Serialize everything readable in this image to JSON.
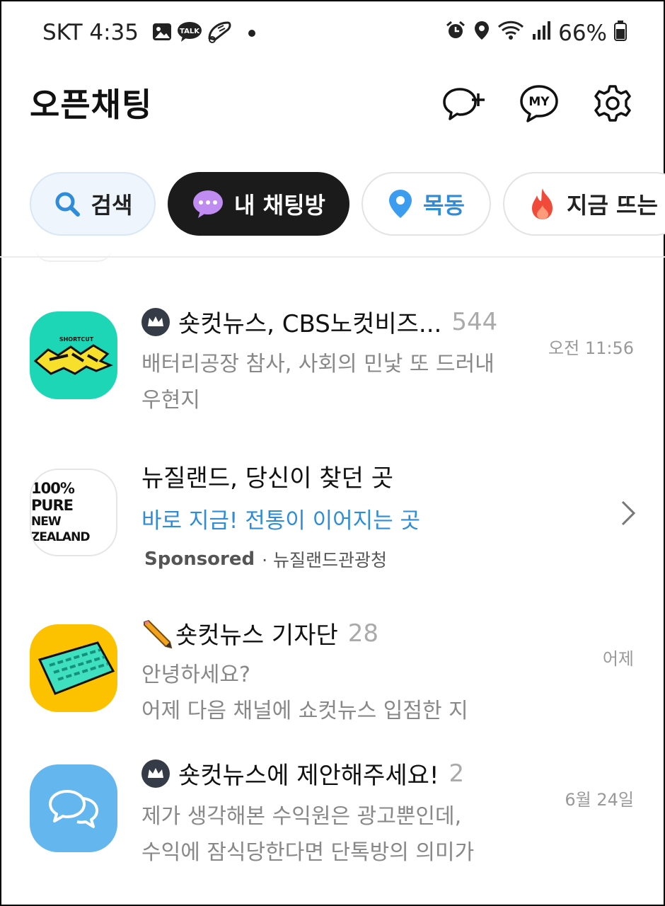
{
  "status_bar": {
    "carrier_time": "SKT 4:35",
    "battery": "66%",
    "left_icons": [
      "gallery-icon",
      "kakaotalk-icon",
      "sneaker-icon",
      "dot-icon"
    ],
    "right_icons": [
      "alarm-icon",
      "location-icon",
      "wifi-icon",
      "signal-icon",
      "battery-icon"
    ]
  },
  "header": {
    "title": "오픈채팅",
    "buttons": [
      "new-chat-icon",
      "my-icon",
      "settings-icon"
    ],
    "my_label": "MY"
  },
  "chips": [
    {
      "label": "검색",
      "icon": "search-icon"
    },
    {
      "label": "내 채팅방",
      "icon": "chat-bubble-icon",
      "active": true
    },
    {
      "label": "목동",
      "icon": "location-pin-icon"
    },
    {
      "label": "지금 뜨는",
      "icon": "fire-icon"
    }
  ],
  "chats": [
    {
      "name": "숏컷뉴스, CBS노컷비즈...",
      "count": "544",
      "time": "오전 11:56",
      "preview_1": "배터리공장 참사, 사회의 민낯 또 드러내",
      "preview_2": "우현지",
      "avatar_text": "SHORTCUT",
      "has_crown": true
    },
    {
      "name": "뉴질랜드, 당신이 찾던 곳",
      "subtitle": "바로 지금! 전통이 이어지는 곳",
      "sponsored": "Sponsored",
      "advertiser": "· 뉴질랜드관광청",
      "avatar_line_1": "100% PURE",
      "avatar_line_2": "NEW ZEALAND"
    },
    {
      "name": "숏컷뉴스 기자단",
      "count": "28",
      "time": "어제",
      "preview_1": "안녕하세요?",
      "preview_2": "어제 다음 채널에 쇼컷뉴스 입점한 지"
    },
    {
      "name": "숏컷뉴스에 제안해주세요!",
      "count": "2",
      "time": "6월 24일",
      "preview_1": "제가 생각해본 수익원은 광고뿐인데,",
      "preview_2": "수익에 잠식당한다면 단톡방의 의미가",
      "has_crown": true
    }
  ],
  "colors": {
    "accent_blue": "#2f8cd8",
    "chip_search_bg": "#eef5fd",
    "chip_active_bg": "#1b1b1b",
    "avatar_1": "#1dd6b6",
    "avatar_3": "#fcc200",
    "avatar_4": "#64b6ef"
  }
}
